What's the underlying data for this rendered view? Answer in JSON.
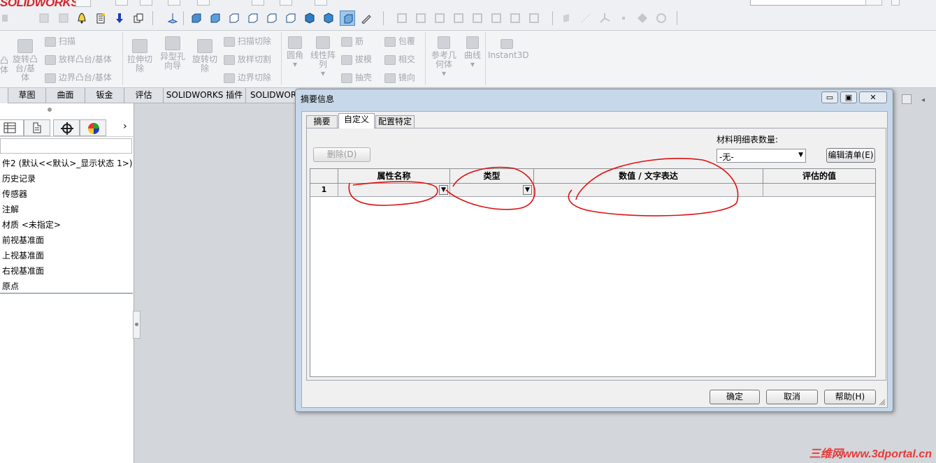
{
  "app": {
    "logo_text": "SOLIDWORKS",
    "brand_color": "#d8232a"
  },
  "ribbon": {
    "sweep_boss": "扫描",
    "revolve_boss": "旋转凸台/基体",
    "loft_boss": "放样凸台/基体",
    "boundary_boss": "边界凸台/基体",
    "extrude_cut": "拉伸切除",
    "hole_wizard": "异型孔向导",
    "revolve_cut": "旋转切除",
    "sweep_cut": "扫描切除",
    "loft_cut": "放样切割",
    "boundary_cut": "边界切除",
    "fillet": "圆角",
    "linear_pattern": "线性阵列",
    "rib": "筋",
    "draft": "拔模",
    "shell": "抽壳",
    "wrap": "包覆",
    "intersect": "相交",
    "mirror": "镜向",
    "ref_geometry": "参考几何体",
    "curves": "曲线",
    "instant3d": "Instant3D"
  },
  "tabs": [
    "草图",
    "曲面",
    "钣金",
    "评估",
    "SOLIDWORKS 插件",
    "SOLIDWORKS"
  ],
  "tree": {
    "root": "件2  (默认<<默认>_显示状态 1>)",
    "items": [
      "历史记录",
      "传感器",
      "注解",
      "材质 <未指定>",
      "前视基准面",
      "上视基准面",
      "右视基准面",
      "原点"
    ]
  },
  "dialog": {
    "title": "摘要信息",
    "window_buttons": {
      "minimize": "▭",
      "restore": "▣",
      "close": "✕"
    },
    "tabs": [
      "摘要",
      "自定义",
      "配置特定"
    ],
    "active_tab": "自定义",
    "delete_button": "删除(D)",
    "bom_label": "材料明细表数量:",
    "bom_value": "-无-",
    "edit_list_button": "编辑清单(E)",
    "table": {
      "headers": [
        "属性名称",
        "类型",
        "数值 / 文字表达",
        "评估的值"
      ],
      "rows": [
        {
          "num": "1",
          "name": "",
          "type": "",
          "value": "",
          "evaluated": ""
        }
      ]
    },
    "ok": "确定",
    "cancel": "取消",
    "help": "帮助(H)"
  },
  "watermark": "三维网www.3dportal.cn",
  "colors": {
    "annotation": "#e01010",
    "dialog_frame": "#c7d8ea"
  }
}
